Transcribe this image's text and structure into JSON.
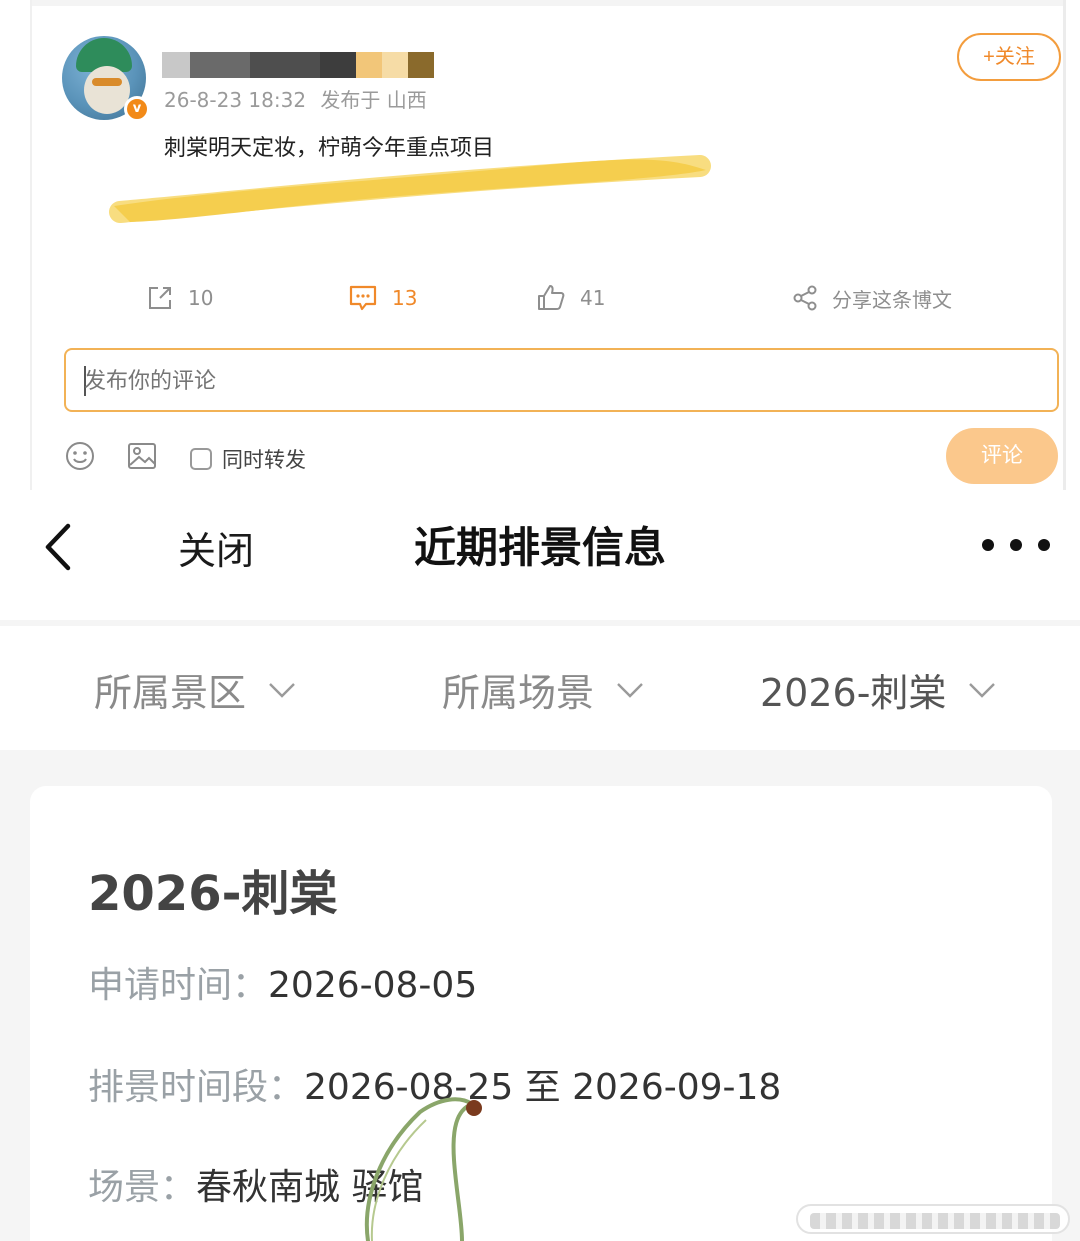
{
  "post": {
    "meta_time": "26-8-23 18:32",
    "meta_location": "发布于 山西",
    "follow_label": "+关注",
    "text": "刺棠明天定妆，柠萌今年重点项目",
    "actions": {
      "repost_count": "10",
      "comment_count": "13",
      "like_count": "41",
      "share_label": "分享这条博文"
    },
    "comment_placeholder": "发布你的评论",
    "repost_option_label": "同时转发",
    "submit_label": "评论",
    "colors": {
      "accent": "#f0892a",
      "submit_bg": "#fbc88c",
      "scribble": "#f2c53a"
    },
    "icons": [
      "verified-badge-icon",
      "repost-icon",
      "comment-icon",
      "like-icon",
      "share-icon",
      "emoji-icon",
      "image-icon"
    ]
  },
  "schedule": {
    "nav": {
      "close_label": "关闭",
      "title": "近期排景信息"
    },
    "filters": [
      {
        "label": "所属景区"
      },
      {
        "label": "所属场景"
      },
      {
        "label": "2026-刺棠"
      }
    ],
    "card": {
      "title": "2026-刺棠",
      "apply_time_key": "申请时间：",
      "apply_time_value": "2026-08-05",
      "period_key": "排景时间段：",
      "period_value": "2026-08-25 至 2026-09-18",
      "scene_key": "场景：",
      "scene_value": "春秋南城 驿馆"
    }
  }
}
